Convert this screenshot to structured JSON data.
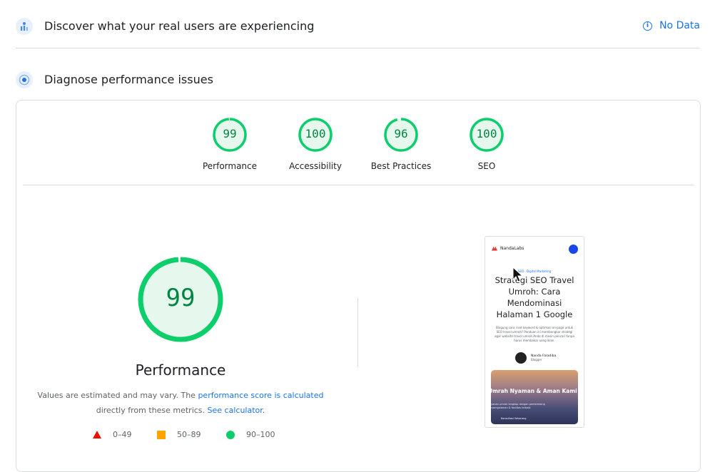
{
  "field_data": {
    "title": "Discover what your real users are experiencing",
    "status": "No Data",
    "icon": "users-chart-icon"
  },
  "lab_data": {
    "title": "Diagnose performance issues",
    "icon": "diagnose-icon"
  },
  "categories": [
    {
      "label": "Performance",
      "score": "99",
      "fraction": 0.99
    },
    {
      "label": "Accessibility",
      "score": "100",
      "fraction": 1.0
    },
    {
      "label": "Best Practices",
      "score": "96",
      "fraction": 0.96
    },
    {
      "label": "SEO",
      "score": "100",
      "fraction": 1.0
    }
  ],
  "performance": {
    "score": "99",
    "fraction": 0.99,
    "label": "Performance",
    "desc_prefix": "Values are estimated and may vary. The ",
    "desc_link1": "performance score is calculated",
    "desc_middle": " directly from these metrics. ",
    "desc_link2": "See calculator",
    "desc_suffix": "."
  },
  "legend": [
    {
      "range": "0–49",
      "color": "#eb0f00",
      "shape": "triangle"
    },
    {
      "range": "50–89",
      "color": "#ffa400",
      "shape": "square"
    },
    {
      "range": "90–100",
      "color": "#0cce6b",
      "shape": "circle"
    }
  ],
  "colors": {
    "pass": "#0cce6b",
    "pass_text": "#018642",
    "pass_fill": "#e6f8ee",
    "accent": "#1a73e8"
  },
  "screenshot": {
    "brand": "NandaLabs",
    "tag": "SEO · Digital Marketing",
    "title": "Strategi SEO Travel Umroh: Cara Mendominasi Halaman 1 Google",
    "excerpt": "Bingung cara riset keyword & optimasi on-page untuk SEO travel umroh? Panduan ini membongkar strategi agar website travel umroh Anda di mesin pencari tanpa harus membakar uang iklan.",
    "author_name": "Nanda Faradiba",
    "author_role": "Blogger",
    "card_title": "Umrah Nyaman & Aman Kami",
    "card_sub": "Layanan umroh lengkap dengan pembimbing berpengalaman & fasilitas terbaik",
    "card_button": "Konsultasi Sekarang"
  }
}
